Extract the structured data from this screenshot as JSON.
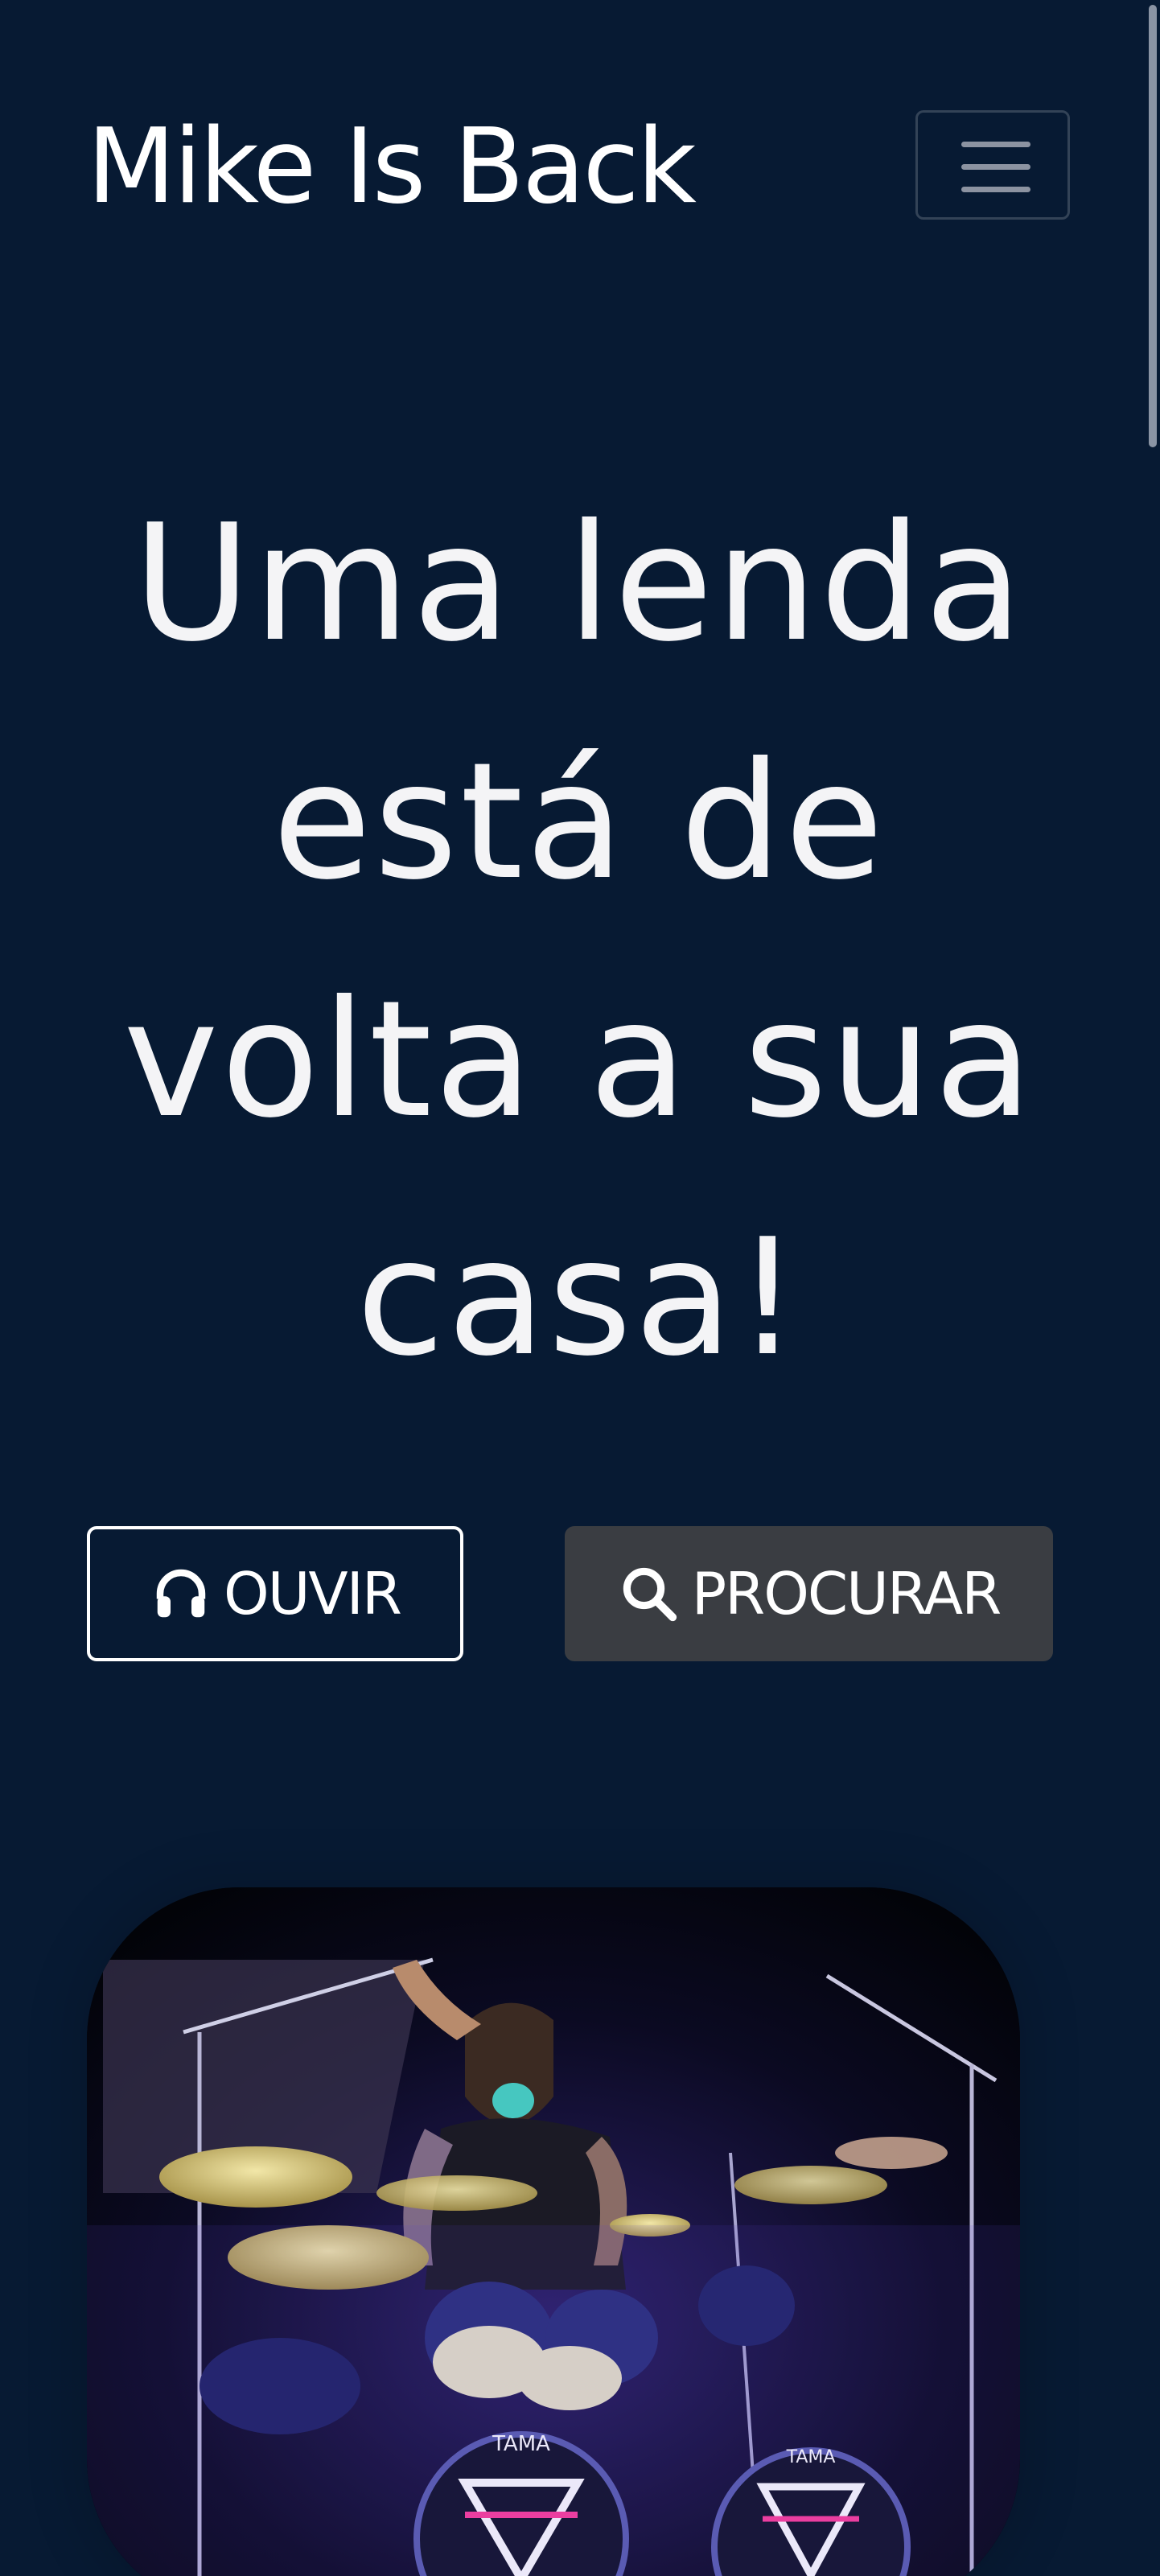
{
  "navbar": {
    "brand": "Mike Is Back",
    "toggler_icon": "hamburger-menu-icon"
  },
  "hero": {
    "title": "Uma lenda está de volta a sua casa!",
    "buttons": {
      "listen": {
        "label": "OUVIR",
        "icon": "headphones-icon"
      },
      "search": {
        "label": "PROCURAR",
        "icon": "search-icon"
      }
    }
  },
  "image": {
    "subject": "drummer-on-stage-photo",
    "drum_brand": "TAMA"
  },
  "colors": {
    "background": "#071a33",
    "text": "#ffffff",
    "search_button_bg": "#3a3d42",
    "toggler_icon": "#8c93a1"
  }
}
